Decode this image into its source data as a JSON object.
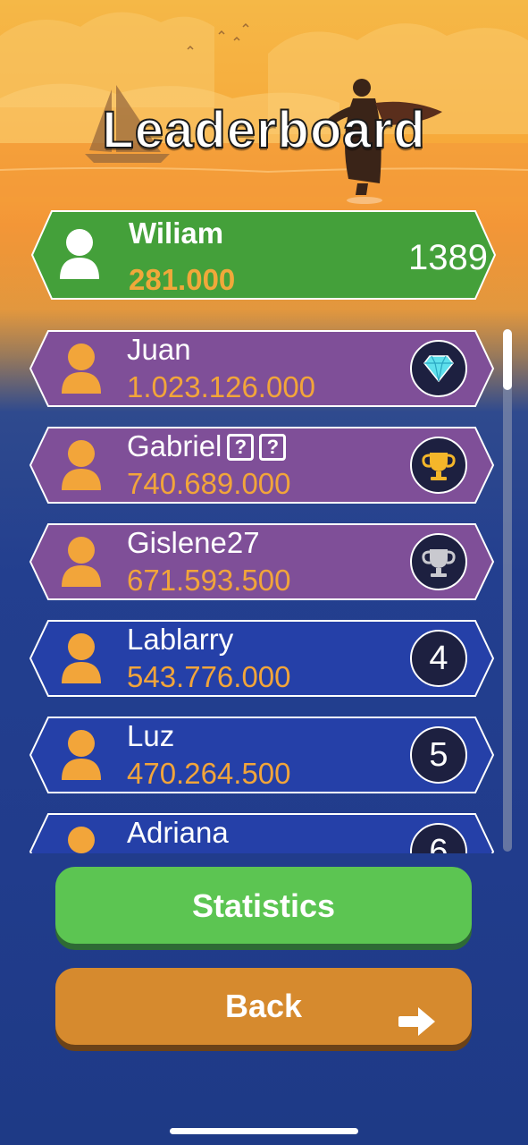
{
  "header": {
    "title": "Leaderboard"
  },
  "current_player": {
    "name": "Wiliam",
    "score": "281.000",
    "rank": "1389",
    "avatar_icon": "user-icon"
  },
  "leaderboard": {
    "rows": [
      {
        "name": "Juan",
        "score": "1.023.126.000",
        "rank_badge": "diamond-icon",
        "color": "#7f4f98"
      },
      {
        "name": "Gabriel",
        "score": "740.689.000",
        "rank_badge": "gold-trophy-icon",
        "color": "#7f4f98",
        "tags": [
          "?",
          "?"
        ]
      },
      {
        "name": "Gislene27",
        "score": "671.593.500",
        "rank_badge": "silver-trophy-icon",
        "color": "#7f4f98"
      },
      {
        "name": "Lablarry",
        "score": "543.776.000",
        "rank": "4",
        "color": "#2540a8"
      },
      {
        "name": "Luz",
        "score": "470.264.500",
        "rank": "5",
        "color": "#2540a8"
      },
      {
        "name": "Adriana",
        "score": "",
        "rank": "6",
        "color": "#2540a8"
      }
    ]
  },
  "buttons": {
    "statistics": "Statistics",
    "back": "Back"
  },
  "colors": {
    "accent_green": "#5cc552",
    "me_row_green": "#44a03a",
    "score_orange": "#f2a53a",
    "back_orange": "#d68a2e"
  }
}
